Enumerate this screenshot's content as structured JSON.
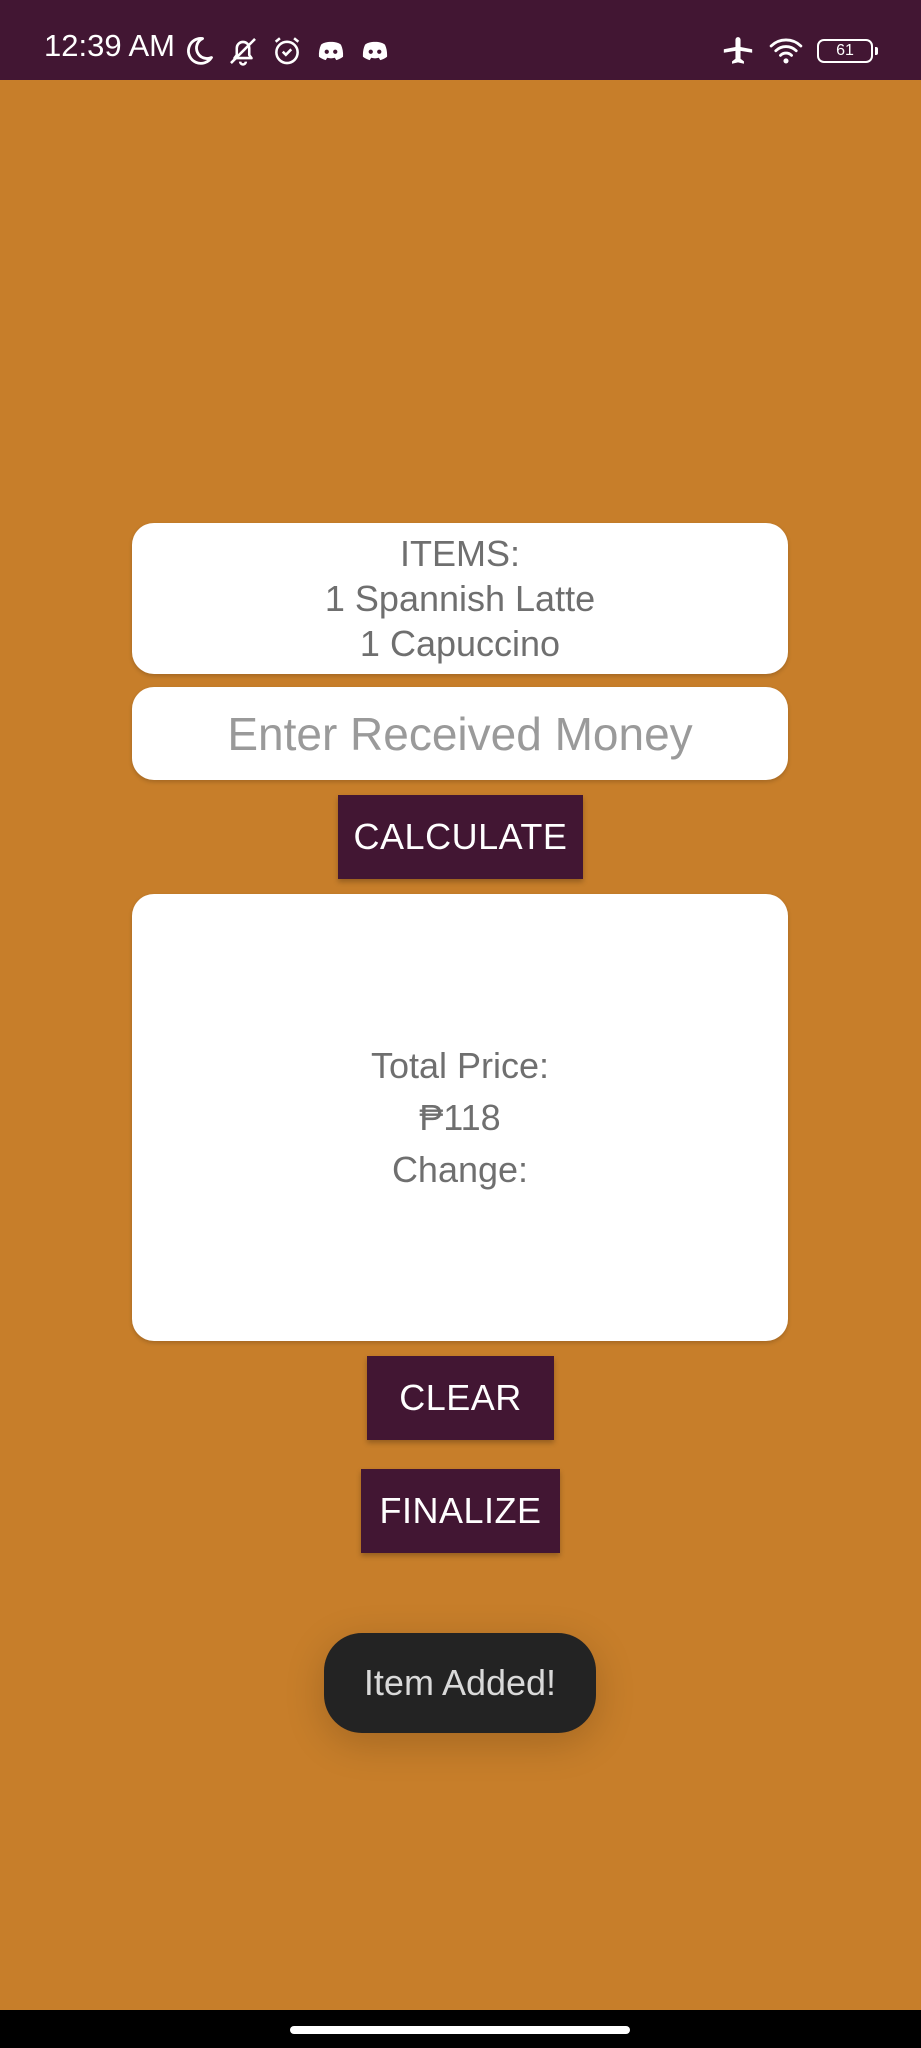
{
  "status_bar": {
    "time": "12:39 AM",
    "battery_level": "61",
    "icons_left": [
      "moon-icon",
      "bell-off-icon",
      "alarm-icon",
      "discord-icon",
      "discord-icon"
    ],
    "icons_right": [
      "airplane-icon",
      "wifi-icon",
      "battery-icon"
    ],
    "colors": {
      "background": "#421633",
      "foreground": "#ffffff"
    }
  },
  "app": {
    "background_color": "#c77e2a",
    "accent_color": "#421633",
    "items_card": {
      "lines": [
        "ITEMS:",
        "1 Spannish Latte",
        "1 Capuccino"
      ]
    },
    "money_input": {
      "value": "",
      "placeholder": "Enter Received Money"
    },
    "calculate_label": "CALCULATE",
    "result_card": {
      "total_label": "Total Price:",
      "total_value": "₱118",
      "change_label": "Change:"
    },
    "clear_label": "CLEAR",
    "finalize_label": "FINALIZE"
  },
  "toast": {
    "message": "Item Added!"
  }
}
